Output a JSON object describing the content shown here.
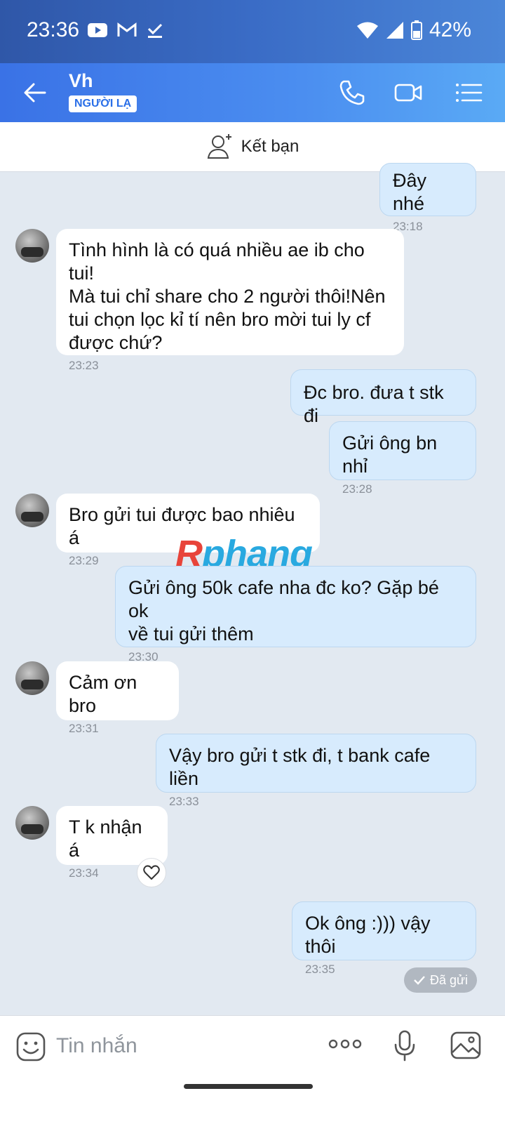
{
  "status_bar": {
    "time": "23:36",
    "battery": "42%",
    "icons": [
      "youtube-icon",
      "gmail-icon",
      "check-icon",
      "wifi-icon",
      "signal-icon",
      "battery-icon"
    ]
  },
  "header": {
    "name": "Vh",
    "badge": "NGƯỜI LẠ"
  },
  "add_friend": {
    "label": "Kết bạn"
  },
  "watermark": {
    "first": "R",
    "rest": "phang"
  },
  "messages": [
    {
      "dir": "out",
      "text": "Đây nhé",
      "time": "23:18"
    },
    {
      "dir": "in",
      "text": "Tình hình là có quá nhiều ae ib cho tui!\nMà tui chỉ share cho 2 người thôi!Nên\ntui chọn lọc kỉ tí nên bro mời tui ly cf\nđược chứ?",
      "time": "23:23"
    },
    {
      "dir": "out",
      "text": "Đc bro. đưa t stk đi",
      "time": ""
    },
    {
      "dir": "out",
      "text": "Gửi ông bn nhỉ",
      "time": "23:28"
    },
    {
      "dir": "in",
      "text": "Bro gửi tui được bao nhiêu á",
      "time": "23:29"
    },
    {
      "dir": "out",
      "text": "Gửi ông 50k cafe nha đc ko? Gặp bé ok\nvề tui gửi thêm",
      "time": "23:30"
    },
    {
      "dir": "in",
      "text": "Cảm ơn bro",
      "time": "23:31"
    },
    {
      "dir": "out",
      "text": "Vậy bro gửi t stk đi, t bank cafe liền",
      "time": "23:33"
    },
    {
      "dir": "in",
      "text": "T k nhận á",
      "time": "23:34"
    },
    {
      "dir": "out",
      "text": "Ok ông :))) vậy thôi",
      "time": "23:35"
    }
  ],
  "sent_status": "Đã gửi",
  "input": {
    "placeholder": "Tin nhắn"
  },
  "colors": {
    "header": "#3a72e6",
    "out_bubble": "#d7ebfd",
    "background": "#e2e9f1"
  }
}
